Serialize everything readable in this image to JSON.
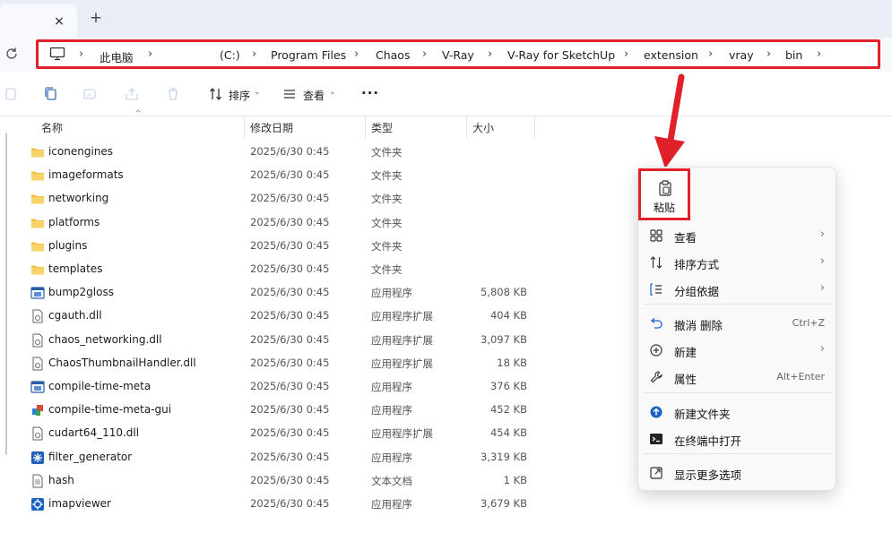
{
  "tabs": {
    "close_glyph": "×",
    "new_glyph": "+"
  },
  "address": {
    "crumbs": [
      "此电脑",
      "(C:)",
      "Program Files",
      "Chaos",
      "V-Ray",
      "V-Ray for SketchUp",
      "extension",
      "vray",
      "bin"
    ]
  },
  "toolbar": {
    "sort_label": "排序",
    "view_label": "查看",
    "more_label": "···"
  },
  "columns": {
    "name": "名称",
    "date": "修改日期",
    "type": "类型",
    "size": "大小"
  },
  "files": [
    {
      "name": "iconengines",
      "date": "2025/6/30 0:45",
      "type": "文件夹",
      "size": "",
      "icon": "folder-icon"
    },
    {
      "name": "imageformats",
      "date": "2025/6/30 0:45",
      "type": "文件夹",
      "size": "",
      "icon": "folder-icon"
    },
    {
      "name": "networking",
      "date": "2025/6/30 0:45",
      "type": "文件夹",
      "size": "",
      "icon": "folder-icon"
    },
    {
      "name": "platforms",
      "date": "2025/6/30 0:45",
      "type": "文件夹",
      "size": "",
      "icon": "folder-icon"
    },
    {
      "name": "plugins",
      "date": "2025/6/30 0:45",
      "type": "文件夹",
      "size": "",
      "icon": "folder-icon"
    },
    {
      "name": "templates",
      "date": "2025/6/30 0:45",
      "type": "文件夹",
      "size": "",
      "icon": "folder-icon"
    },
    {
      "name": "bump2gloss",
      "date": "2025/6/30 0:45",
      "type": "应用程序",
      "size": "5,808 KB",
      "icon": "app-icon"
    },
    {
      "name": "cgauth.dll",
      "date": "2025/6/30 0:45",
      "type": "应用程序扩展",
      "size": "404 KB",
      "icon": "dll-icon"
    },
    {
      "name": "chaos_networking.dll",
      "date": "2025/6/30 0:45",
      "type": "应用程序扩展",
      "size": "3,097 KB",
      "icon": "dll-icon"
    },
    {
      "name": "ChaosThumbnailHandler.dll",
      "date": "2025/6/30 0:45",
      "type": "应用程序扩展",
      "size": "18 KB",
      "icon": "dll-icon"
    },
    {
      "name": "compile-time-meta",
      "date": "2025/6/30 0:45",
      "type": "应用程序",
      "size": "376 KB",
      "icon": "app-icon"
    },
    {
      "name": "compile-time-meta-gui",
      "date": "2025/6/30 0:45",
      "type": "应用程序",
      "size": "452 KB",
      "icon": "gui-app-icon"
    },
    {
      "name": "cudart64_110.dll",
      "date": "2025/6/30 0:45",
      "type": "应用程序扩展",
      "size": "454 KB",
      "icon": "dll-icon"
    },
    {
      "name": "filter_generator",
      "date": "2025/6/30 0:45",
      "type": "应用程序",
      "size": "3,319 KB",
      "icon": "filter-app-icon"
    },
    {
      "name": "hash",
      "date": "2025/6/30 0:45",
      "type": "文本文档",
      "size": "1 KB",
      "icon": "text-file-icon"
    },
    {
      "name": "imapviewer",
      "date": "2025/6/30 0:45",
      "type": "应用程序",
      "size": "3,679 KB",
      "icon": "imap-app-icon"
    }
  ],
  "context_menu": {
    "paste_label": "粘贴",
    "items": [
      {
        "label": "查看",
        "shortcut": "",
        "submenu": true,
        "icon": "view-grid-icon"
      },
      {
        "label": "排序方式",
        "shortcut": "",
        "submenu": true,
        "icon": "sort-icon"
      },
      {
        "label": "分组依据",
        "shortcut": "",
        "submenu": true,
        "icon": "group-by-icon"
      },
      {
        "label": "撤消 删除",
        "shortcut": "Ctrl+Z",
        "submenu": false,
        "icon": "undo-icon"
      },
      {
        "label": "新建",
        "shortcut": "",
        "submenu": true,
        "icon": "new-plus-icon"
      },
      {
        "label": "属性",
        "shortcut": "Alt+Enter",
        "submenu": false,
        "icon": "wrench-icon"
      },
      {
        "label": "新建文件夹",
        "shortcut": "",
        "submenu": false,
        "icon": "new-folder-icon"
      },
      {
        "label": "在终端中打开",
        "shortcut": "",
        "submenu": false,
        "icon": "terminal-icon"
      },
      {
        "label": "显示更多选项",
        "shortcut": "",
        "submenu": false,
        "icon": "more-options-icon"
      }
    ],
    "arrow_glyph": "›"
  },
  "colors": {
    "highlight_red": "#e0202a",
    "folder_yellow": "#f2c14a",
    "accent_blue": "#1a62c7"
  }
}
